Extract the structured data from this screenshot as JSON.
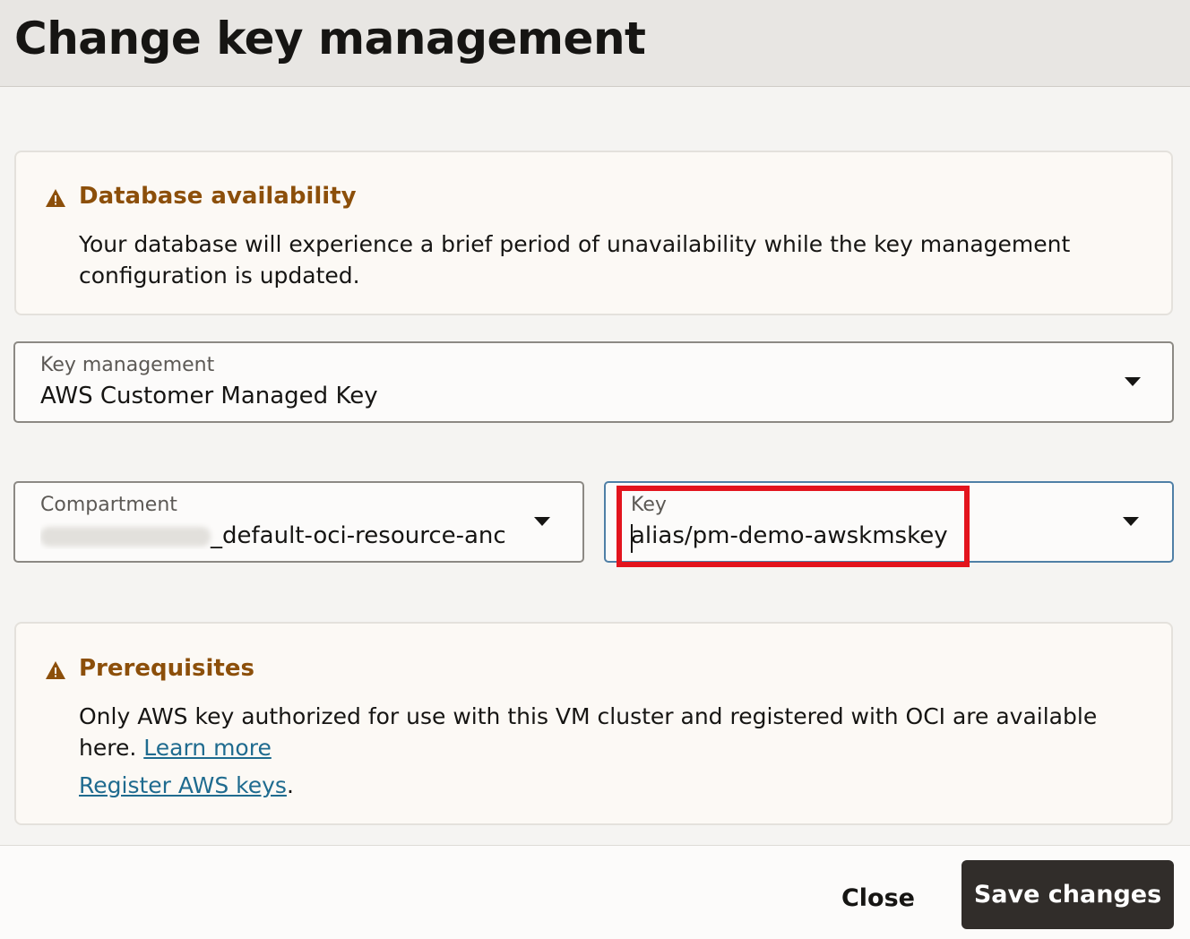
{
  "dialog": {
    "title": "Change key management"
  },
  "availability_alert": {
    "icon": "warning-icon",
    "title": "Database availability",
    "body": "Your database will experience a brief period of unavailability while the key management configuration is updated."
  },
  "key_management": {
    "label": "Key management",
    "value": "AWS Customer Managed Key"
  },
  "compartment": {
    "label": "Compartment",
    "value_suffix": "_default-oci-resource-ancl"
  },
  "key": {
    "label": "Key",
    "value": "alias/pm-demo-awskmskey"
  },
  "prereq_alert": {
    "icon": "warning-icon",
    "title": "Prerequisites",
    "body": "Only AWS key authorized for use with this VM cluster and registered with OCI are available here.",
    "learn_more": "Learn more",
    "register_link": "Register AWS keys",
    "register_suffix": "."
  },
  "footer": {
    "close_label": "Close",
    "save_label": "Save changes"
  },
  "colors": {
    "warning": "#8c4f0a",
    "link": "#1f6b8f",
    "primary_button": "#312d2a",
    "highlight": "#e3141d"
  }
}
